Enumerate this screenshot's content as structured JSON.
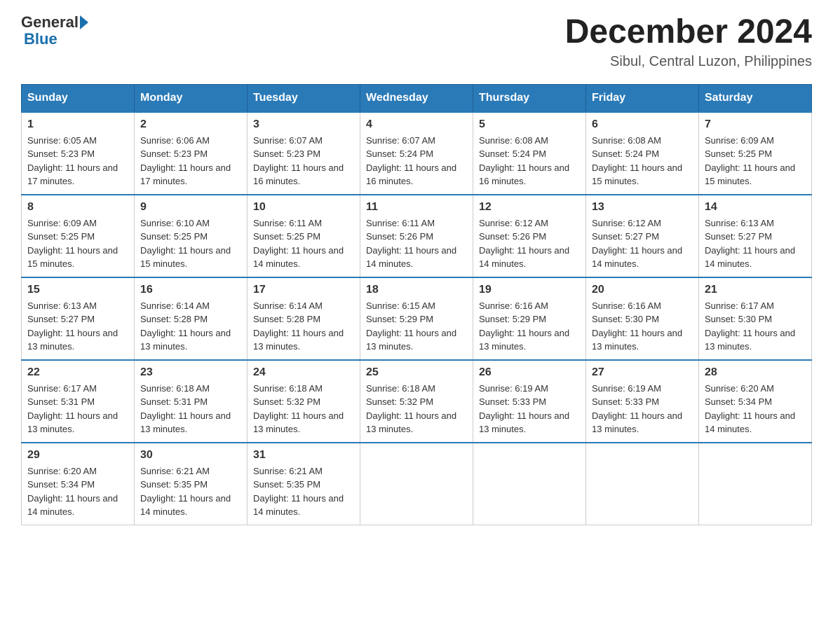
{
  "header": {
    "logo_general": "General",
    "logo_blue": "Blue",
    "month_title": "December 2024",
    "location": "Sibul, Central Luzon, Philippines"
  },
  "days_of_week": [
    "Sunday",
    "Monday",
    "Tuesday",
    "Wednesday",
    "Thursday",
    "Friday",
    "Saturday"
  ],
  "weeks": [
    [
      {
        "day": "1",
        "sunrise": "6:05 AM",
        "sunset": "5:23 PM",
        "daylight": "11 hours and 17 minutes."
      },
      {
        "day": "2",
        "sunrise": "6:06 AM",
        "sunset": "5:23 PM",
        "daylight": "11 hours and 17 minutes."
      },
      {
        "day": "3",
        "sunrise": "6:07 AM",
        "sunset": "5:23 PM",
        "daylight": "11 hours and 16 minutes."
      },
      {
        "day": "4",
        "sunrise": "6:07 AM",
        "sunset": "5:24 PM",
        "daylight": "11 hours and 16 minutes."
      },
      {
        "day": "5",
        "sunrise": "6:08 AM",
        "sunset": "5:24 PM",
        "daylight": "11 hours and 16 minutes."
      },
      {
        "day": "6",
        "sunrise": "6:08 AM",
        "sunset": "5:24 PM",
        "daylight": "11 hours and 15 minutes."
      },
      {
        "day": "7",
        "sunrise": "6:09 AM",
        "sunset": "5:25 PM",
        "daylight": "11 hours and 15 minutes."
      }
    ],
    [
      {
        "day": "8",
        "sunrise": "6:09 AM",
        "sunset": "5:25 PM",
        "daylight": "11 hours and 15 minutes."
      },
      {
        "day": "9",
        "sunrise": "6:10 AM",
        "sunset": "5:25 PM",
        "daylight": "11 hours and 15 minutes."
      },
      {
        "day": "10",
        "sunrise": "6:11 AM",
        "sunset": "5:25 PM",
        "daylight": "11 hours and 14 minutes."
      },
      {
        "day": "11",
        "sunrise": "6:11 AM",
        "sunset": "5:26 PM",
        "daylight": "11 hours and 14 minutes."
      },
      {
        "day": "12",
        "sunrise": "6:12 AM",
        "sunset": "5:26 PM",
        "daylight": "11 hours and 14 minutes."
      },
      {
        "day": "13",
        "sunrise": "6:12 AM",
        "sunset": "5:27 PM",
        "daylight": "11 hours and 14 minutes."
      },
      {
        "day": "14",
        "sunrise": "6:13 AM",
        "sunset": "5:27 PM",
        "daylight": "11 hours and 14 minutes."
      }
    ],
    [
      {
        "day": "15",
        "sunrise": "6:13 AM",
        "sunset": "5:27 PM",
        "daylight": "11 hours and 13 minutes."
      },
      {
        "day": "16",
        "sunrise": "6:14 AM",
        "sunset": "5:28 PM",
        "daylight": "11 hours and 13 minutes."
      },
      {
        "day": "17",
        "sunrise": "6:14 AM",
        "sunset": "5:28 PM",
        "daylight": "11 hours and 13 minutes."
      },
      {
        "day": "18",
        "sunrise": "6:15 AM",
        "sunset": "5:29 PM",
        "daylight": "11 hours and 13 minutes."
      },
      {
        "day": "19",
        "sunrise": "6:16 AM",
        "sunset": "5:29 PM",
        "daylight": "11 hours and 13 minutes."
      },
      {
        "day": "20",
        "sunrise": "6:16 AM",
        "sunset": "5:30 PM",
        "daylight": "11 hours and 13 minutes."
      },
      {
        "day": "21",
        "sunrise": "6:17 AM",
        "sunset": "5:30 PM",
        "daylight": "11 hours and 13 minutes."
      }
    ],
    [
      {
        "day": "22",
        "sunrise": "6:17 AM",
        "sunset": "5:31 PM",
        "daylight": "11 hours and 13 minutes."
      },
      {
        "day": "23",
        "sunrise": "6:18 AM",
        "sunset": "5:31 PM",
        "daylight": "11 hours and 13 minutes."
      },
      {
        "day": "24",
        "sunrise": "6:18 AM",
        "sunset": "5:32 PM",
        "daylight": "11 hours and 13 minutes."
      },
      {
        "day": "25",
        "sunrise": "6:18 AM",
        "sunset": "5:32 PM",
        "daylight": "11 hours and 13 minutes."
      },
      {
        "day": "26",
        "sunrise": "6:19 AM",
        "sunset": "5:33 PM",
        "daylight": "11 hours and 13 minutes."
      },
      {
        "day": "27",
        "sunrise": "6:19 AM",
        "sunset": "5:33 PM",
        "daylight": "11 hours and 13 minutes."
      },
      {
        "day": "28",
        "sunrise": "6:20 AM",
        "sunset": "5:34 PM",
        "daylight": "11 hours and 14 minutes."
      }
    ],
    [
      {
        "day": "29",
        "sunrise": "6:20 AM",
        "sunset": "5:34 PM",
        "daylight": "11 hours and 14 minutes."
      },
      {
        "day": "30",
        "sunrise": "6:21 AM",
        "sunset": "5:35 PM",
        "daylight": "11 hours and 14 minutes."
      },
      {
        "day": "31",
        "sunrise": "6:21 AM",
        "sunset": "5:35 PM",
        "daylight": "11 hours and 14 minutes."
      },
      null,
      null,
      null,
      null
    ]
  ],
  "labels": {
    "sunrise": "Sunrise:",
    "sunset": "Sunset:",
    "daylight": "Daylight:"
  }
}
